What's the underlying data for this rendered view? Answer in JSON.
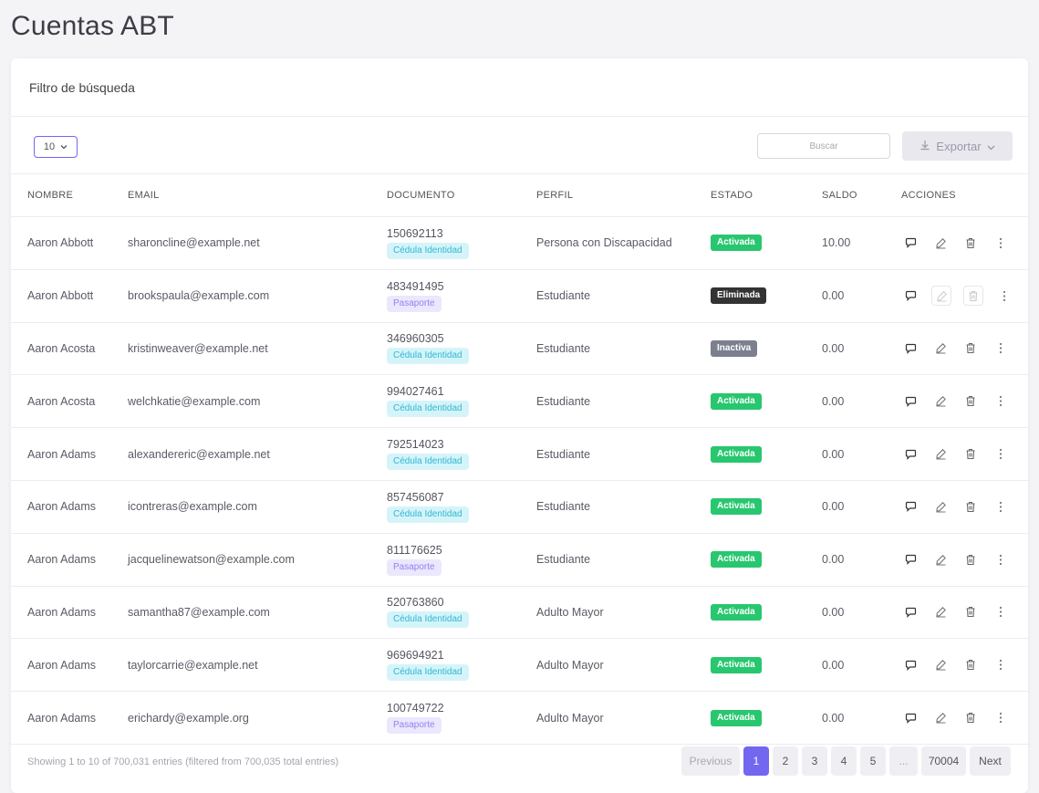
{
  "page_title": "Cuentas ABT",
  "filter_title": "Filtro de búsqueda",
  "length_select": {
    "value": "10"
  },
  "search": {
    "placeholder": "Buscar"
  },
  "export_label": "Exportar",
  "columns": [
    "NOMBRE",
    "EMAIL",
    "DOCUMENTO",
    "PERFIL",
    "ESTADO",
    "SALDO",
    "ACCIONES"
  ],
  "rows": [
    {
      "nombre": "Aaron Abbott",
      "email": "sharoncline@example.net",
      "doc_num": "150692113",
      "doc_type": "Cédula Identidad",
      "perfil": "Persona con Discapacidad",
      "estado": "Activada",
      "saldo": "10.00"
    },
    {
      "nombre": "Aaron Abbott",
      "email": "brookspaula@example.com",
      "doc_num": "483491495",
      "doc_type": "Pasaporte",
      "perfil": "Estudiante",
      "estado": "Eliminada",
      "saldo": "0.00"
    },
    {
      "nombre": "Aaron Acosta",
      "email": "kristinweaver@example.net",
      "doc_num": "346960305",
      "doc_type": "Cédula Identidad",
      "perfil": "Estudiante",
      "estado": "Inactiva",
      "saldo": "0.00"
    },
    {
      "nombre": "Aaron Acosta",
      "email": "welchkatie@example.com",
      "doc_num": "994027461",
      "doc_type": "Cédula Identidad",
      "perfil": "Estudiante",
      "estado": "Activada",
      "saldo": "0.00"
    },
    {
      "nombre": "Aaron Adams",
      "email": "alexandereric@example.net",
      "doc_num": "792514023",
      "doc_type": "Cédula Identidad",
      "perfil": "Estudiante",
      "estado": "Activada",
      "saldo": "0.00"
    },
    {
      "nombre": "Aaron Adams",
      "email": "icontreras@example.com",
      "doc_num": "857456087",
      "doc_type": "Cédula Identidad",
      "perfil": "Estudiante",
      "estado": "Activada",
      "saldo": "0.00"
    },
    {
      "nombre": "Aaron Adams",
      "email": "jacquelinewatson@example.com",
      "doc_num": "811176625",
      "doc_type": "Pasaporte",
      "perfil": "Estudiante",
      "estado": "Activada",
      "saldo": "0.00"
    },
    {
      "nombre": "Aaron Adams",
      "email": "samantha87@example.com",
      "doc_num": "520763860",
      "doc_type": "Cédula Identidad",
      "perfil": "Adulto Mayor",
      "estado": "Activada",
      "saldo": "0.00"
    },
    {
      "nombre": "Aaron Adams",
      "email": "taylorcarrie@example.net",
      "doc_num": "969694921",
      "doc_type": "Cédula Identidad",
      "perfil": "Adulto Mayor",
      "estado": "Activada",
      "saldo": "0.00"
    },
    {
      "nombre": "Aaron Adams",
      "email": "erichardy@example.org",
      "doc_num": "100749722",
      "doc_type": "Pasaporte",
      "perfil": "Adulto Mayor",
      "estado": "Activada",
      "saldo": "0.00"
    }
  ],
  "row_actions": [
    "chat-icon",
    "edit-icon",
    "trash-icon",
    "more-vertical-icon"
  ],
  "footer_info": "Showing 1 to 10 of 700,031 entries (filtered from 700,035 total entries)",
  "pagination": {
    "previous": "Previous",
    "pages": [
      "1",
      "2",
      "3",
      "4",
      "5"
    ],
    "active_page": "1",
    "ellipsis": "...",
    "last": "70004",
    "next": "Next"
  },
  "colors": {
    "accent": "#7367f0",
    "activada": "#28c76f",
    "eliminada": "#333333",
    "inactiva": "#7b7f8e",
    "cedula_bg": "#d5f4fa",
    "pasaporte_bg": "#ebe7fd"
  }
}
